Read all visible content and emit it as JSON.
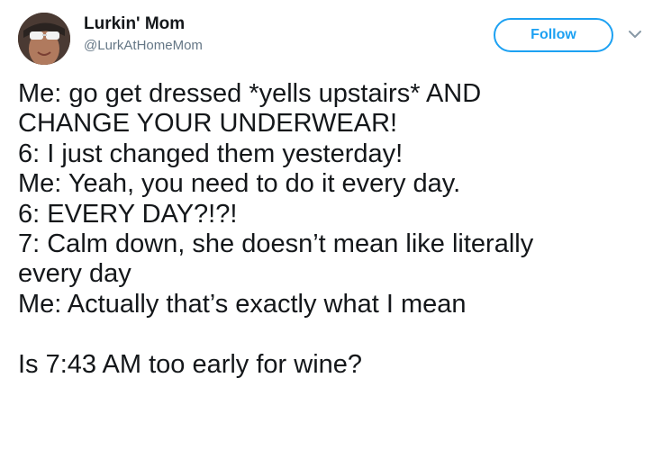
{
  "author": {
    "name": "Lurkin' Mom",
    "handle": "@LurkAtHomeMom",
    "avatar_icon": "profile-photo"
  },
  "actions": {
    "follow_label": "Follow",
    "menu_icon": "chevron-down-icon"
  },
  "tweet": {
    "lines": [
      "Me: go get dressed *yells upstairs* AND",
      "CHANGE YOUR UNDERWEAR!",
      "6: I just changed them yesterday!",
      "Me: Yeah, you need to do it every day.",
      "6: EVERY DAY?!?!",
      "7: Calm down, she doesn’t mean like literally",
      "every day",
      "Me: Actually that’s exactly what I mean",
      "",
      "Is 7:43 AM too early for wine?"
    ]
  },
  "colors": {
    "accent": "#1da1f2",
    "text": "#14171a",
    "secondary_text": "#657786"
  }
}
